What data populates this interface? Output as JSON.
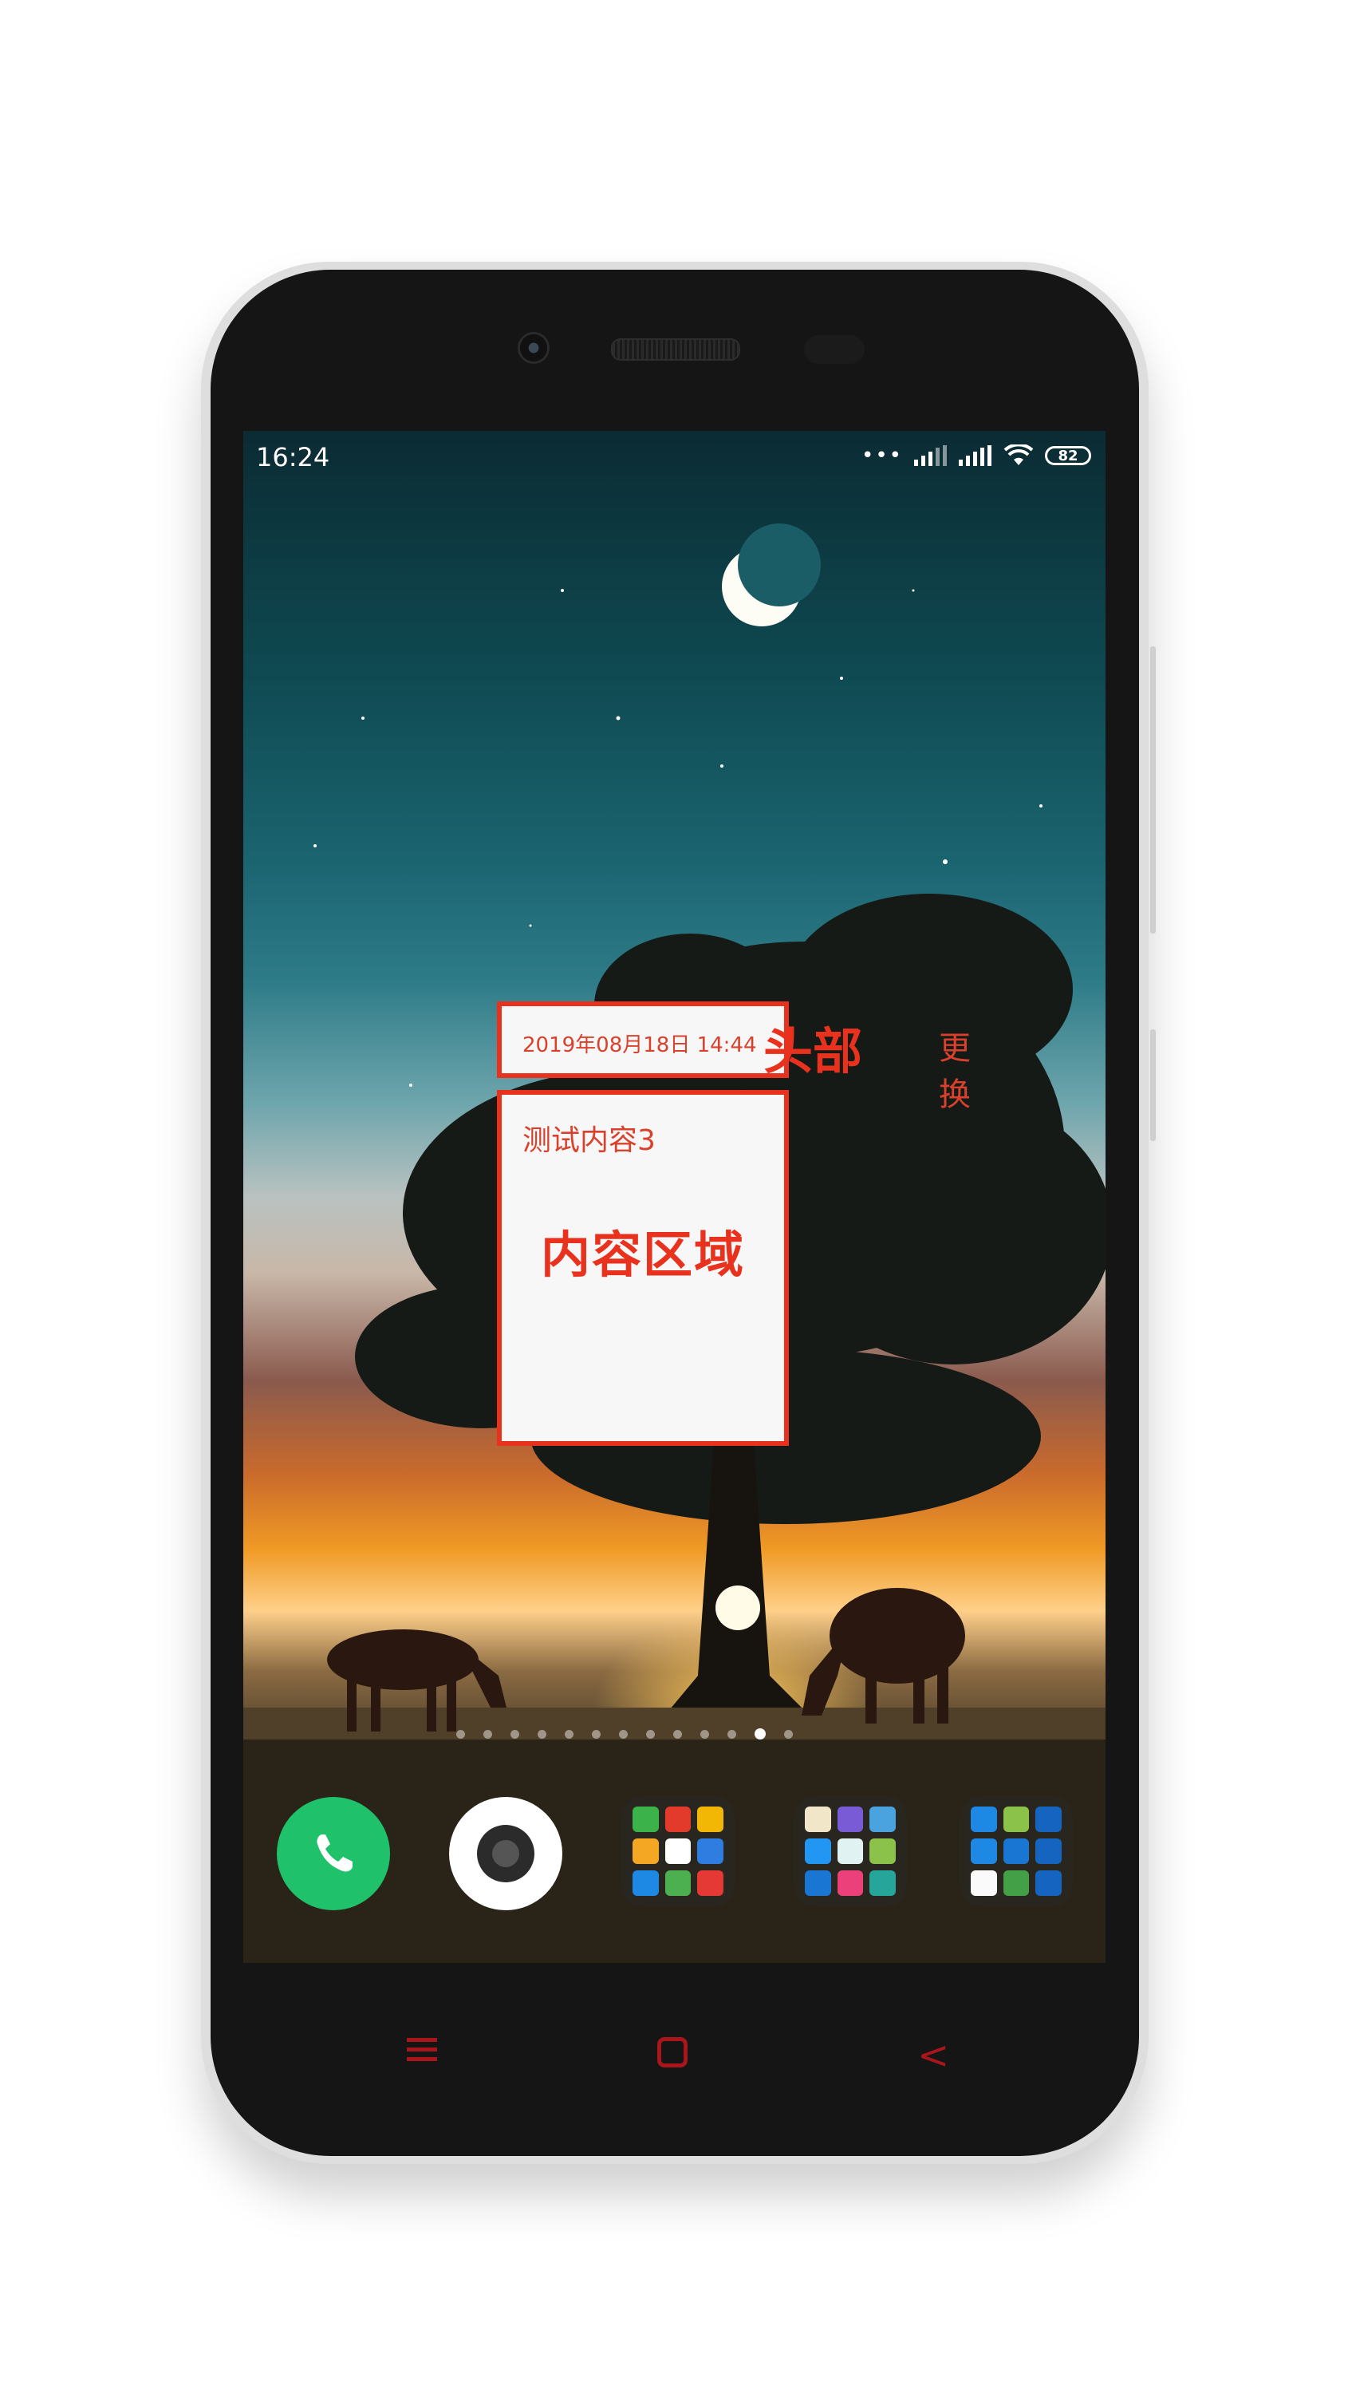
{
  "status_bar": {
    "time": "16:24",
    "signal_dots": "•••",
    "battery": "82"
  },
  "widget": {
    "header": {
      "date": "2019年08月18日 14:44",
      "title": "头部",
      "change_button": "更换"
    },
    "content": {
      "text": "测试内容3",
      "title": "内容区域"
    }
  },
  "home_screen": {
    "page_count": 13,
    "active_page": 12,
    "dock": [
      "phone-app",
      "camera-app",
      "app-folder-1",
      "app-folder-2",
      "app-folder-3"
    ]
  },
  "colors": {
    "widget_border": "#e8321e",
    "widget_text": "#d9412c",
    "phone_app": "#1fc16b",
    "nav_keys": "#a8161b"
  }
}
